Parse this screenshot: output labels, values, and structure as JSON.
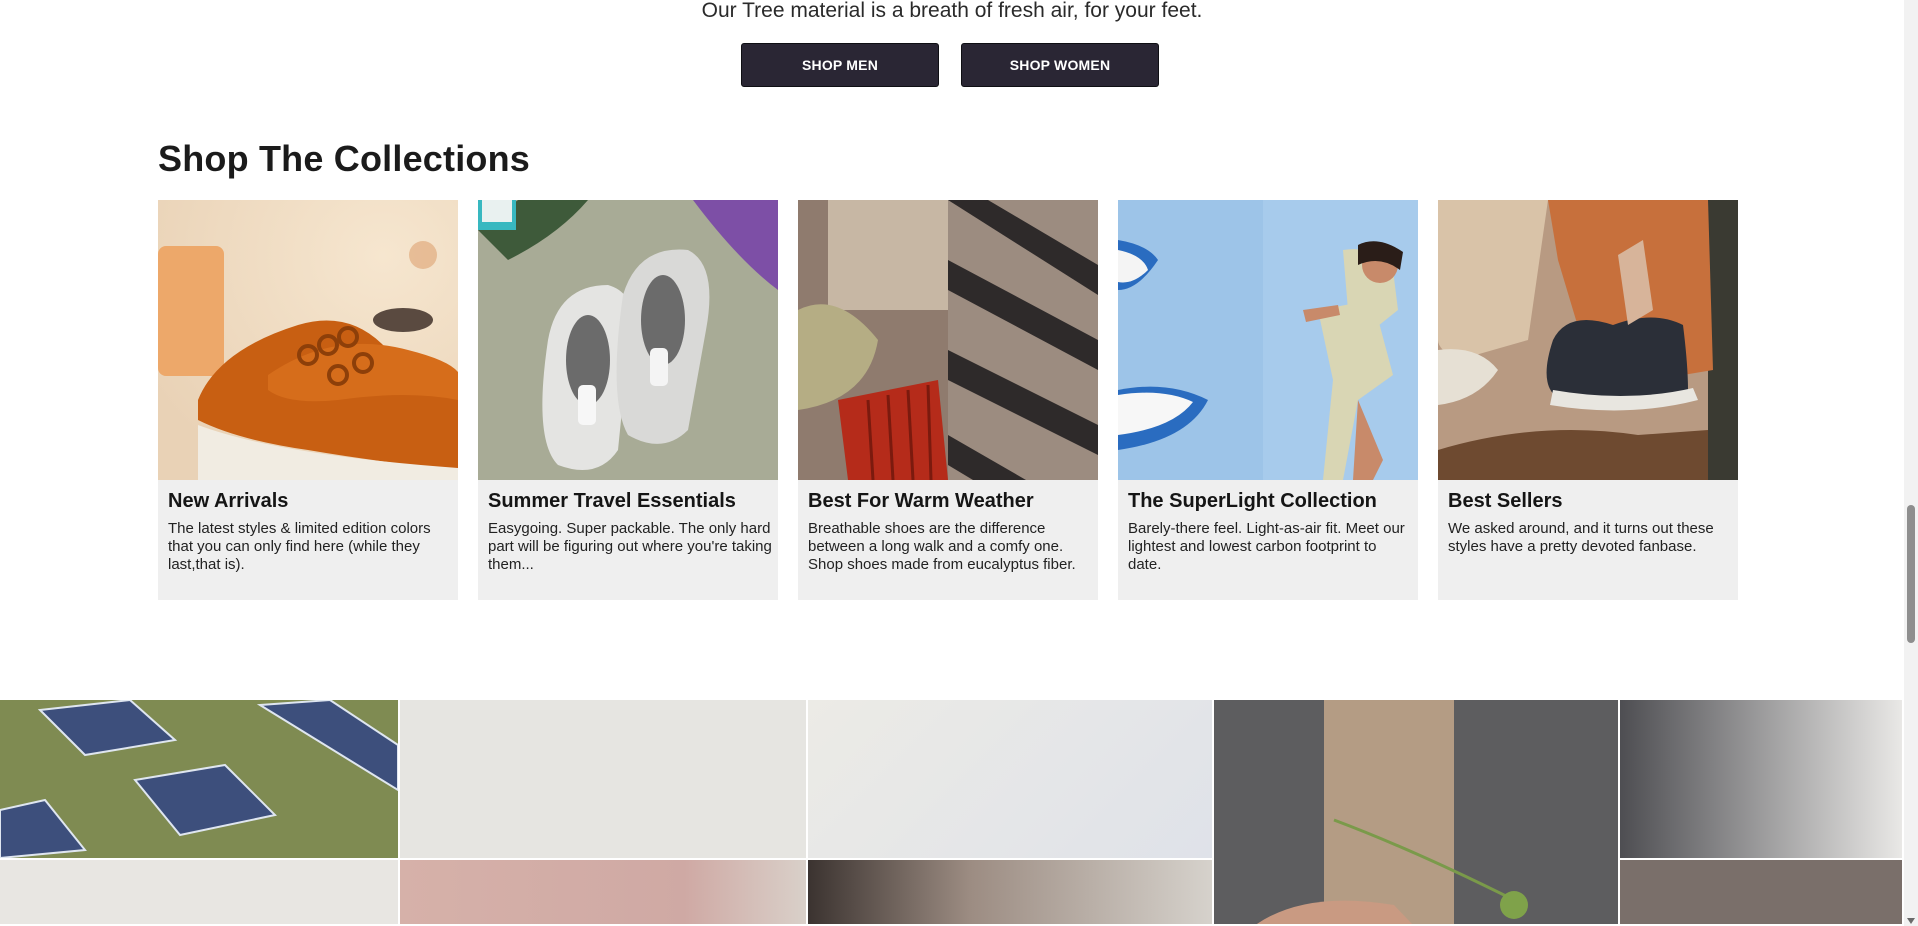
{
  "hero": {
    "tagline": "Our Tree material is a breath of fresh air, for your feet.",
    "shop_men_label": "SHOP MEN",
    "shop_women_label": "SHOP WOMEN"
  },
  "collections": {
    "title": "Shop The Collections",
    "cards": [
      {
        "name": "New Arrivals",
        "description": "The latest styles & limited edition colors that you can only find here (while they last,that is)."
      },
      {
        "name": "Summer Travel Essentials",
        "description": "Easygoing. Super packable. The only hard part will be figuring out where you're taking them..."
      },
      {
        "name": "Best For Warm Weather",
        "description": "Breathable shoes are the difference between a long walk and a comfy one. Shop shoes made from eucalyptus fiber."
      },
      {
        "name": "The SuperLight Collection",
        "description": "Barely-there feel. Light-as-air fit. Meet our lightest and lowest carbon footprint to date."
      },
      {
        "name": "Best Sellers",
        "description": "We asked around, and it turns out these styles have a pretty devoted fanbase."
      }
    ]
  },
  "colors": {
    "button_bg": "#2a2634",
    "card_bg": "#efefef"
  }
}
